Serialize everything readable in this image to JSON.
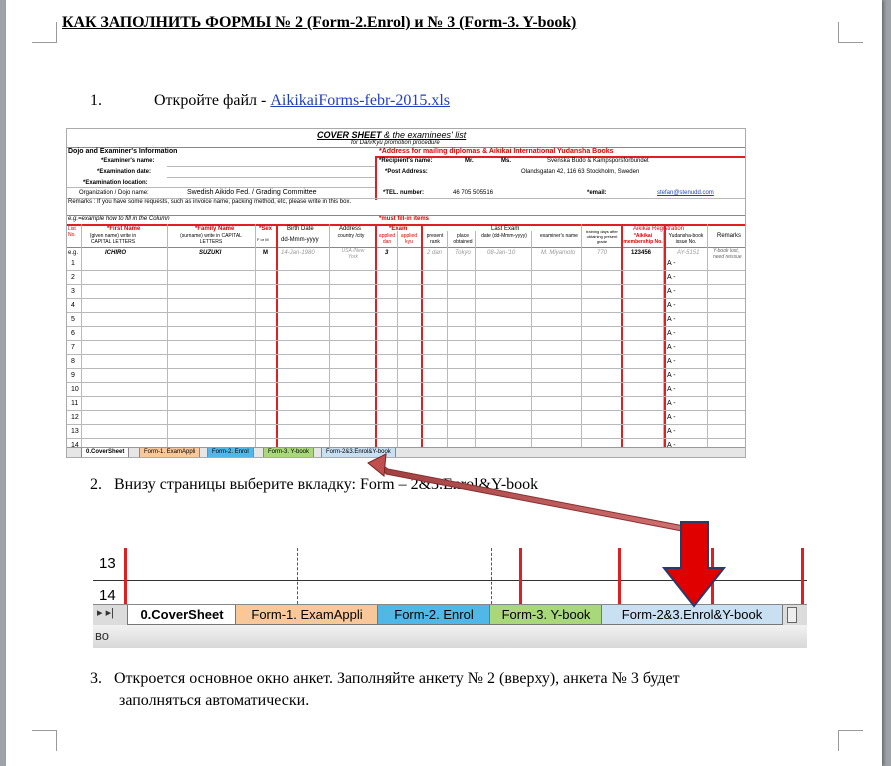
{
  "title": "КАК ЗАПОЛНИТЬ ФОРМЫ № 2 (Form-2.Enrol) и № 3 (Form-3. Y-book)",
  "steps": [
    {
      "num": "1.",
      "text": "Откройте файл - ",
      "link": "AikikaiForms-febr-2015.xls"
    },
    {
      "num": "2.",
      "text": "Внизу страницы выберите вкладку: Form – 2&3.Enrol&Y-book"
    },
    {
      "num": "3.",
      "text": "Откроется основное окно анкет. Заполняйте анкету № 2 (вверху), анкета № 3 будет",
      "text2": "заполняться автоматически."
    }
  ],
  "sheet": {
    "cover_title": "COVER SHEET",
    "cover_sub": " & the examinees' list",
    "cover_sub2": "for Dan/Kyu promotion procedure",
    "section_left": "Dojo and Examiner's Information",
    "section_right": "*Address for mailing diplomas & Aikikai International Yudansha Books",
    "examiner_name": "*Examiner's name:",
    "exam_date": "*Examination date:",
    "exam_location": "*Examination location:",
    "org_label": "Organization / Dojo name:",
    "org_value": "Swedish Aikido Fed. / Grading Committee",
    "recipient_label": "*Recipient's name:",
    "mr": "Mr.",
    "ms": "Ms.",
    "recipient_value": "Svenska Budo & Kampsporsforbundet",
    "post_label": "*Post Address:",
    "post_value": "Olandsgatan 42, 116 63 Stockholm, Sweden",
    "tel_label": "*TEL. number:",
    "tel_value": "46 705 505516",
    "email_label": "*email:",
    "email_value": "stefan@stenudd.com",
    "remarks": "Remarks : If you have some requests, such as invoice name, packing method, etc, please write in this box.",
    "example_note": "e.g.=example how to fill in the Column",
    "must_fill": "*must fill-in items",
    "headers": [
      "List No.",
      "*First Name",
      "*Family Name",
      "*Sex",
      "Birth Date",
      "Address",
      "*Exam",
      "Last Exam",
      "Aikikai Registration",
      "Remarks"
    ],
    "sub_headers": [
      "(given name) write in CAPITAL LETTERS",
      "(surname) write in CAPITAL LETTERS",
      "F or M",
      "dd-Mmm-yyyy",
      "country /city",
      "applied dan",
      "applied kyu",
      "present rank",
      "place obtained",
      "date (dd-Mmm-yyyy)",
      "examiner's name",
      "training days after obtaining present grade",
      "*Aikikai membership No.",
      "Yudansha-book issue No."
    ],
    "example_row": [
      "e.g.",
      "ICHIRO",
      "SUZUKI",
      "M",
      "14-Jan-1980",
      "USA /New York",
      "3",
      "",
      "2 dan",
      "Tokyo",
      "08-Jan-'10",
      "M. Miyamoto",
      "770",
      "123456",
      "AY-5151",
      "Y-book lost, need reissue"
    ],
    "row_numbers": [
      "1",
      "2",
      "3",
      "4",
      "5",
      "6",
      "7",
      "8",
      "9",
      "10",
      "11",
      "12",
      "13",
      "14"
    ],
    "a_mark": "A  -",
    "tabs": [
      "0.CoverSheet",
      "Form-1. ExamAppli",
      "Form-2. Enrol",
      "Form-3. Y-book",
      "Form-2&3.Enrol&Y-book"
    ]
  },
  "zoom": {
    "row_13": "13",
    "row_14": "14",
    "nav": "▸ ▸|",
    "tabs": [
      "0.CoverSheet",
      "Form-1. ExamAppli",
      "Form-2. Enrol",
      "Form-3. Y-book",
      "Form-2&3.Enrol&Y-book"
    ],
    "bottom_label": "во"
  },
  "colors": {
    "tab_exam": "#f9c89a",
    "tab_enrol": "#4fb8e8",
    "tab_ybook": "#a8d87a",
    "tab_both": "#c9dff2",
    "arrow": "#e00000",
    "line_arrow": "#c05050"
  }
}
